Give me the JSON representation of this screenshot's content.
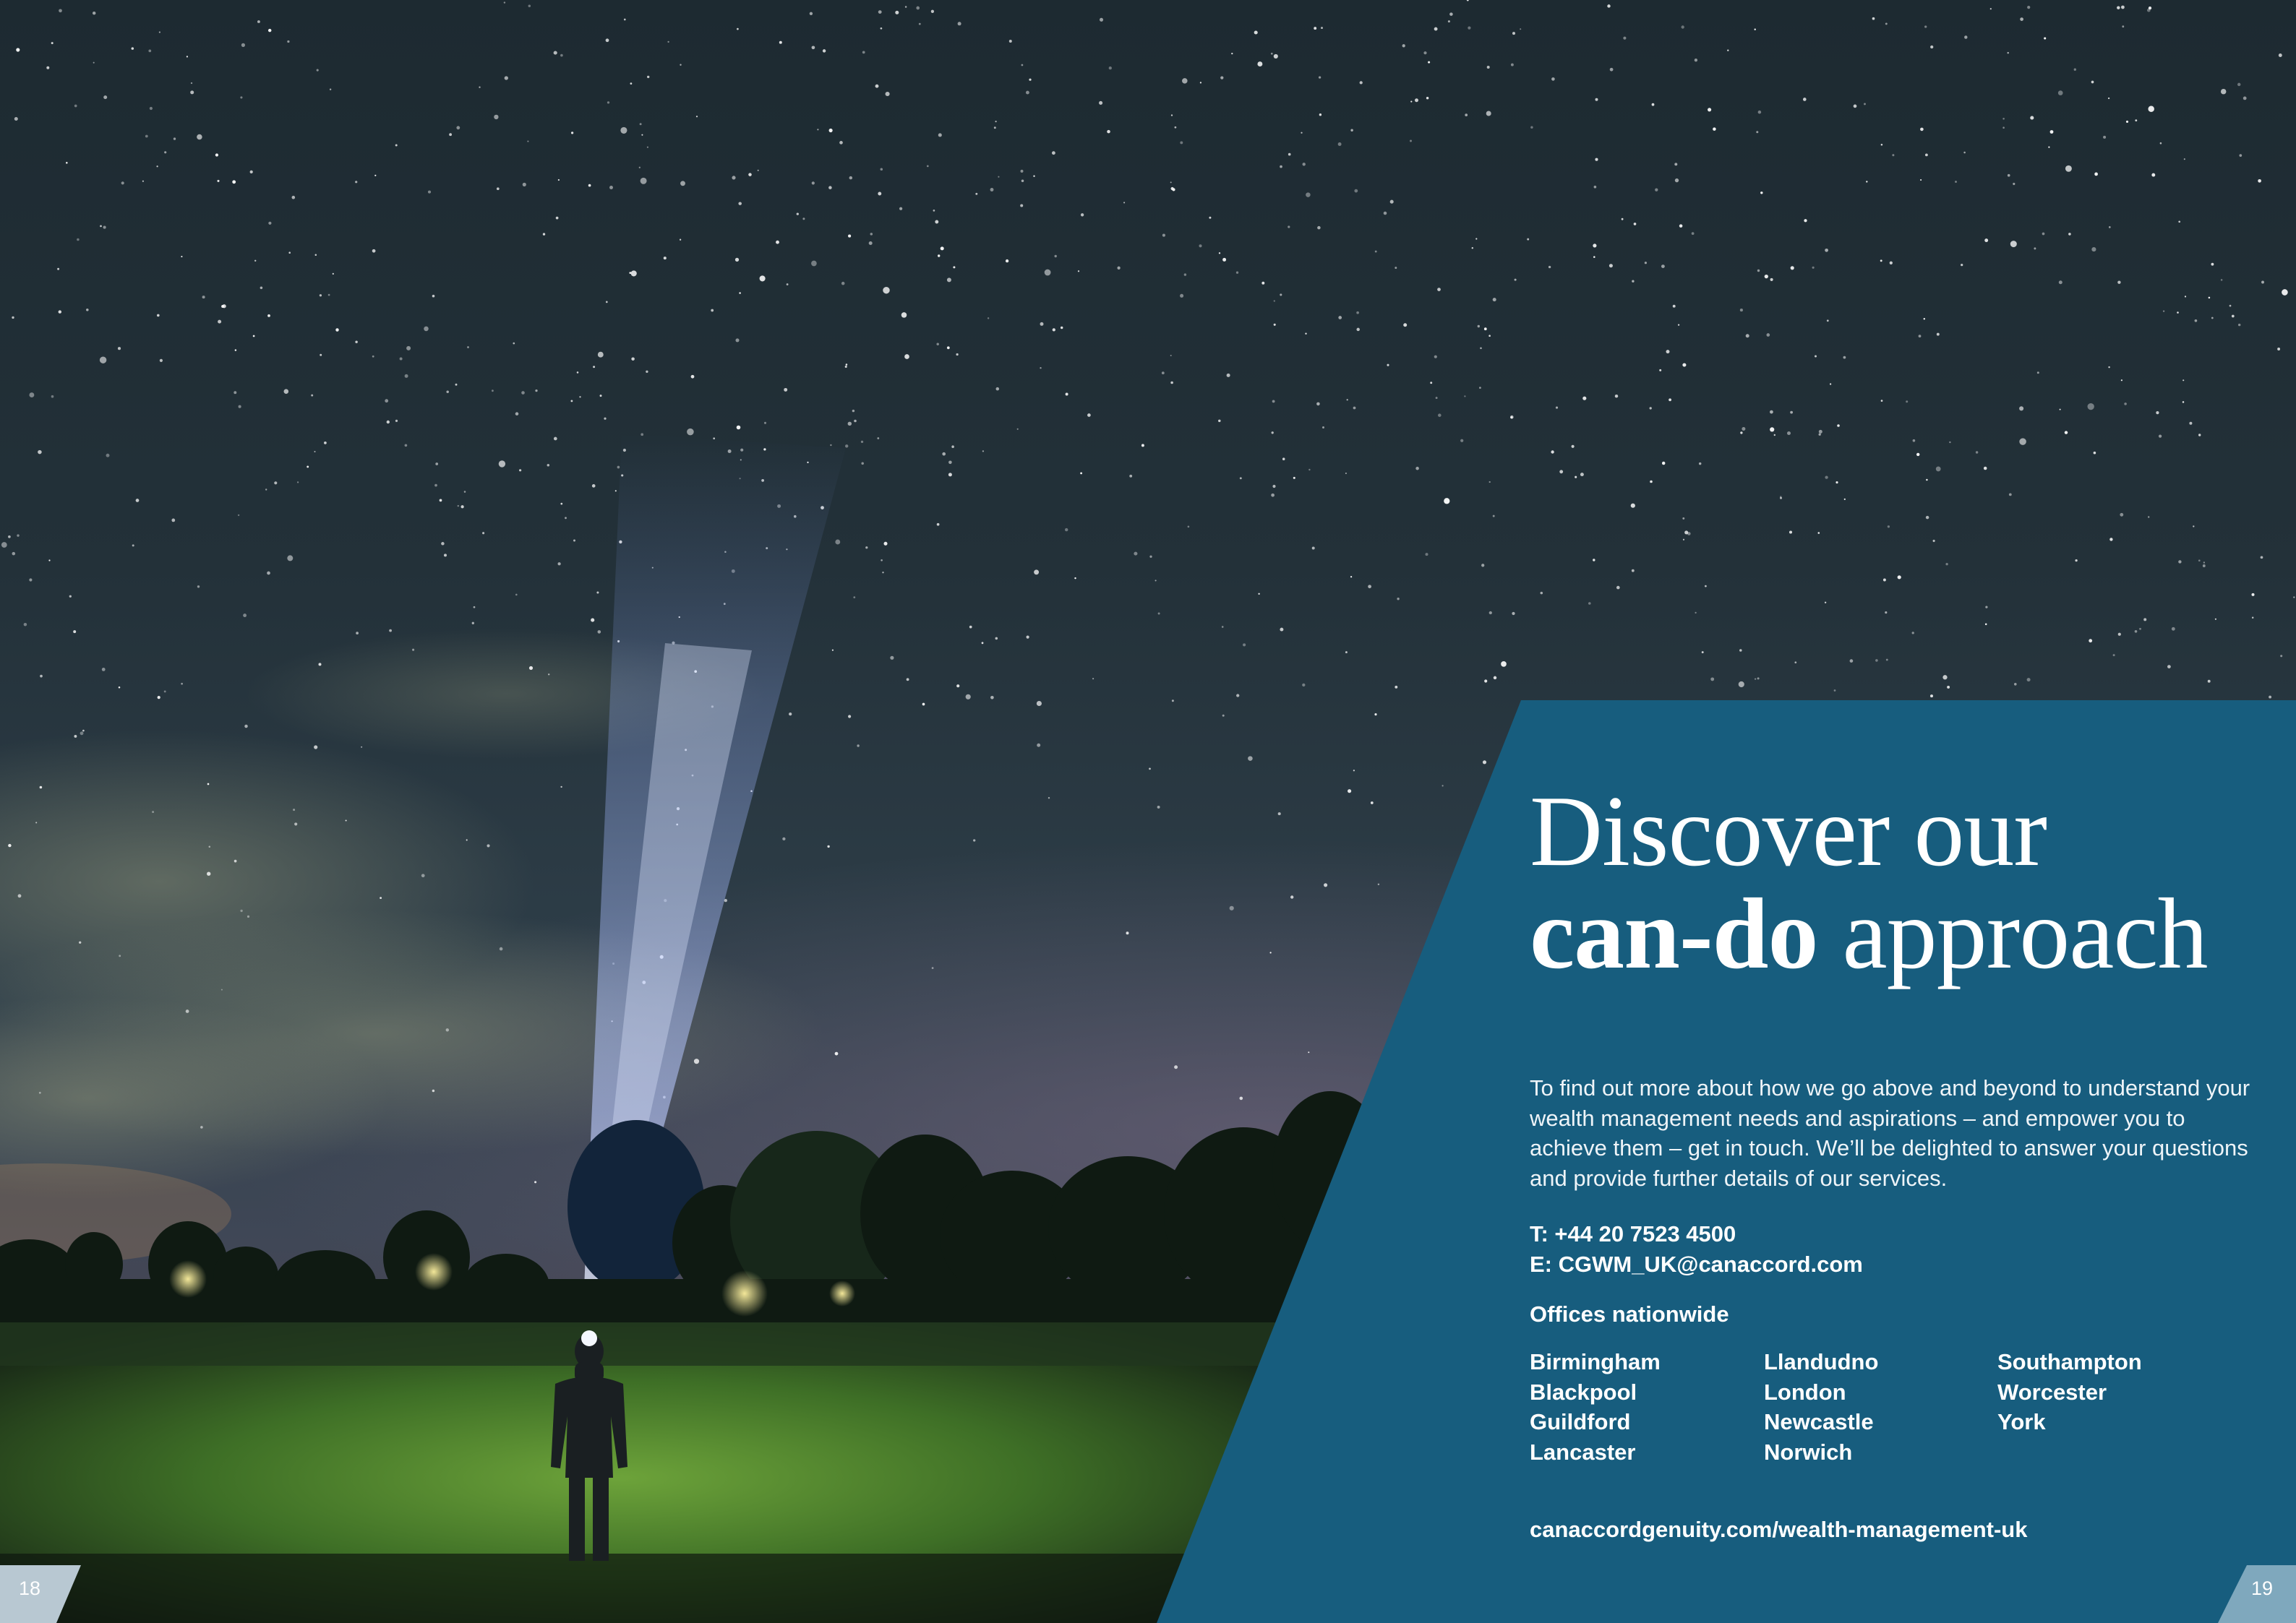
{
  "headline": {
    "line1": "Discover our",
    "line2_bold": "can-do",
    "line2_rest": " approach"
  },
  "intro": "To find out more about how we go above and beyond to understand your wealth management needs and aspirations – and empower you to achieve them – get in touch. We’ll be delighted to answer your questions and provide further details of our services.",
  "contact": {
    "phone": "T: +44 20 7523 4500",
    "email": "E: CGWM_UK@canaccord.com"
  },
  "offices": {
    "title": "Offices nationwide",
    "columns": [
      [
        "Birmingham",
        "Blackpool",
        "Guildford",
        "Lancaster"
      ],
      [
        "Llandudno",
        "London",
        "Newcastle",
        "Norwich"
      ],
      [
        "Southampton",
        "Worcester",
        "York"
      ]
    ]
  },
  "website": "canaccordgenuity.com/wealth-management-uk",
  "page_numbers": {
    "left": "18",
    "right": "19"
  },
  "colors": {
    "panel": "#175d7e",
    "page_tab_left": "#b8c8d2",
    "page_tab_right": "#7fa8bd",
    "sky_top": "#1c2a33",
    "grass": "#4f8a2c"
  }
}
